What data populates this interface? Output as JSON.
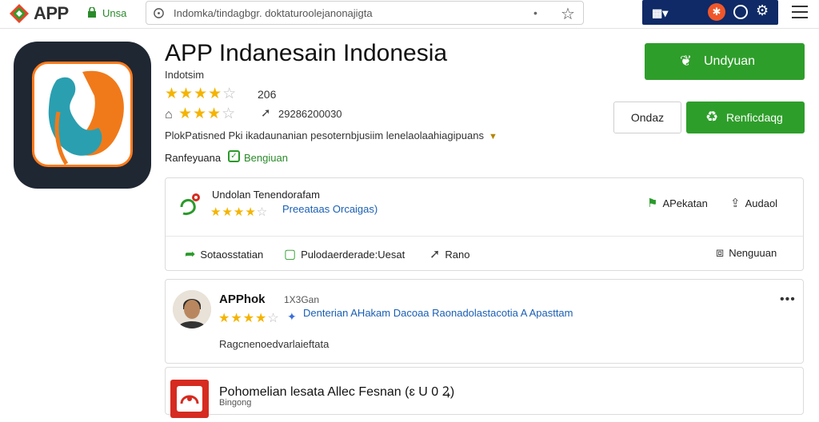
{
  "browser": {
    "brand": "APP",
    "secure_label": "Unsa",
    "url": "Indomka/tindagbgr. doktaturoolejanonajigta",
    "url_menu": "•",
    "accent": "#2e9e2a",
    "ext_panel_color": "#0f2a66"
  },
  "app": {
    "title": "APP Indanesain Indonesia",
    "subtitle": "Indotsim",
    "rating_count": "206",
    "downloads": "29286200030",
    "description": "PlokPatisned Pki ikadaunanian pesoternbjusiim lenelaolaahiagipuans",
    "category": "Ranfeyuana",
    "verified_label": "Bengiuan"
  },
  "buttons": {
    "install": "Undyuan",
    "other": "Ondaz",
    "share": "Renficdaqg"
  },
  "developer_card": {
    "name": "Undolan Tenendorafam",
    "link": "Preeataas Orcaigas)",
    "action1": "APekatan",
    "action2": "Audaol",
    "row_actions": [
      "Sotaosstatian",
      "Pulodaerderade:Uesat",
      "Rano",
      "Nenguuan"
    ]
  },
  "review": {
    "name": "APPhok",
    "time": "1X3Gan",
    "title": "Denterian AHakam Dacoaa Raonadolastacotia A Apasttam",
    "body": "Ragcnenoedvarlaieftata",
    "more": "•••"
  },
  "news": {
    "title": "Pohomelian lesata Allec Fesnan (ɛ U 0 Ꝝ)",
    "subtitle": "Bingong"
  },
  "icons": [
    "app-logo-icon",
    "lock-icon",
    "refresh-icon",
    "star-icon",
    "extension-grid-icon",
    "extension-orange-icon",
    "circle-icon",
    "gear-icon",
    "hamburger-menu-icon",
    "phone-leaf-icon",
    "share-icon",
    "check-icon",
    "install-icon",
    "pin-icon",
    "flag-icon",
    "comment-icon",
    "forward-icon",
    "bookmark-icon",
    "verified-icon",
    "more-icon"
  ]
}
